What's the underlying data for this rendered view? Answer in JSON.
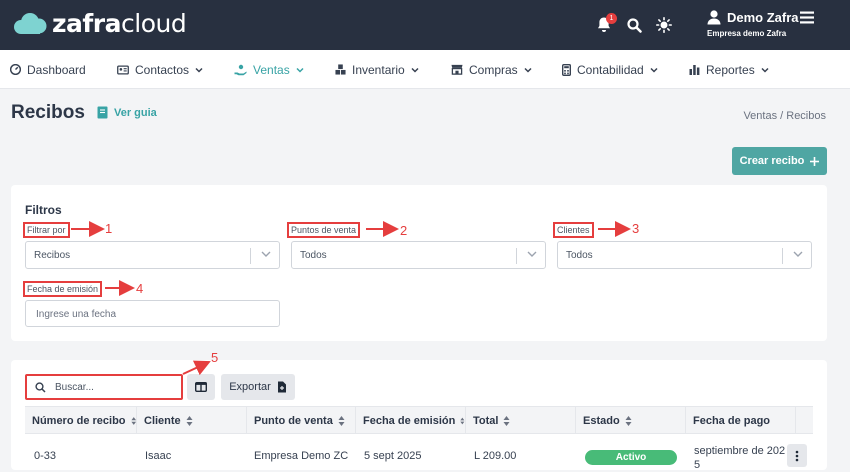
{
  "header": {
    "logo_bold": "zafra",
    "logo_light": "cloud",
    "notification_count": "1",
    "user_name": "Demo Zafra",
    "user_company": "Empresa demo Zafra"
  },
  "nav": {
    "items": [
      {
        "label": "Dashboard",
        "icon": "dashboard-icon",
        "dropdown": false
      },
      {
        "label": "Contactos",
        "icon": "contact-card-icon",
        "dropdown": true
      },
      {
        "label": "Ventas",
        "icon": "hand-coins-icon",
        "dropdown": true,
        "active": true
      },
      {
        "label": "Inventario",
        "icon": "boxes-icon",
        "dropdown": true
      },
      {
        "label": "Compras",
        "icon": "store-icon",
        "dropdown": true
      },
      {
        "label": "Contabilidad",
        "icon": "calculator-icon",
        "dropdown": true
      },
      {
        "label": "Reportes",
        "icon": "bar-chart-icon",
        "dropdown": true
      }
    ]
  },
  "page": {
    "title": "Recibos",
    "guide_label": "Ver guia",
    "breadcrumb": "Ventas  /  Recibos",
    "create_button": "Crear recibo"
  },
  "filters": {
    "title": "Filtros",
    "filter_by_label": "Filtrar por",
    "filter_by_value": "Recibos",
    "pos_label": "Puntos de venta",
    "pos_value": "Todos",
    "clients_label": "Clientes",
    "clients_value": "Todos",
    "date_label": "Fecha de emisión",
    "date_placeholder": "Ingrese una fecha"
  },
  "annotations": [
    "1",
    "2",
    "3",
    "4",
    "5"
  ],
  "table": {
    "search_placeholder": "Buscar...",
    "export_label": "Exportar",
    "columns": [
      "Número de recibo",
      "Cliente",
      "Punto de venta",
      "Fecha de emisión",
      "Total",
      "Estado",
      "Fecha de pago"
    ],
    "rows": [
      {
        "number": "0-33",
        "client": "Isaac",
        "pos": "Empresa Demo ZC",
        "issue_date": "5 sept 2025",
        "total": "L 209.00",
        "status": "Activo",
        "payment_date_line1": "septiembre de 202",
        "payment_date_line2": "5"
      }
    ]
  },
  "colors": {
    "header_bg": "#283040",
    "accent": "#38a3a5",
    "button_bg": "#4fa6a3",
    "status_active": "#48bb78",
    "annotation_red": "#e53e3e"
  }
}
